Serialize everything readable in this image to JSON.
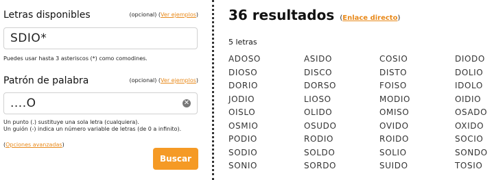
{
  "letters": {
    "title": "Letras disponibles",
    "optional_prefix": "(opcional) (",
    "examples_link": "Ver ejemplos",
    "optional_suffix": ")",
    "value": "SDIO*",
    "help": "Puedes usar hasta 3 asteriscos (*) como comodines."
  },
  "pattern": {
    "title": "Patrón de palabra",
    "optional_prefix": "(opcional) (",
    "examples_link": "Ver ejemplos",
    "optional_suffix": ")",
    "value": "....O",
    "clear_icon": "✕",
    "help_line1": "Un punto (.) sustituye una sola letra (cualquiera).",
    "help_line2": "Un guión (-) indica un número variable de letras (de 0 a infinito)."
  },
  "advanced": {
    "prefix": "(",
    "link": "Opciones avanzadas",
    "suffix": ")"
  },
  "search_button": "Buscar",
  "results": {
    "title": "36 resultados",
    "link_prefix": "(",
    "link": "Enlace directo",
    "link_suffix": ")",
    "group_label": "5 letras",
    "words": [
      "ADOSO",
      "ASIDO",
      "COSIO",
      "DIODO",
      "DIOSO",
      "DISCO",
      "DISTO",
      "DOLIO",
      "DORIO",
      "DORSO",
      "FOISO",
      "IDOLO",
      "JODIO",
      "LIOSO",
      "MODIO",
      "OIDIO",
      "OISLO",
      "OLIDO",
      "OMISO",
      "OSADO",
      "OSMIO",
      "OSUDO",
      "OVIDO",
      "OXIDO",
      "PODIO",
      "RODIO",
      "ROIDO",
      "SOCIO",
      "SODIO",
      "SOLDO",
      "SOLIO",
      "SONDO",
      "SONIO",
      "SORDO",
      "SUIDO",
      "TOSIO"
    ]
  },
  "colors": {
    "accent": "#f59a25",
    "link": "#e8891a"
  }
}
